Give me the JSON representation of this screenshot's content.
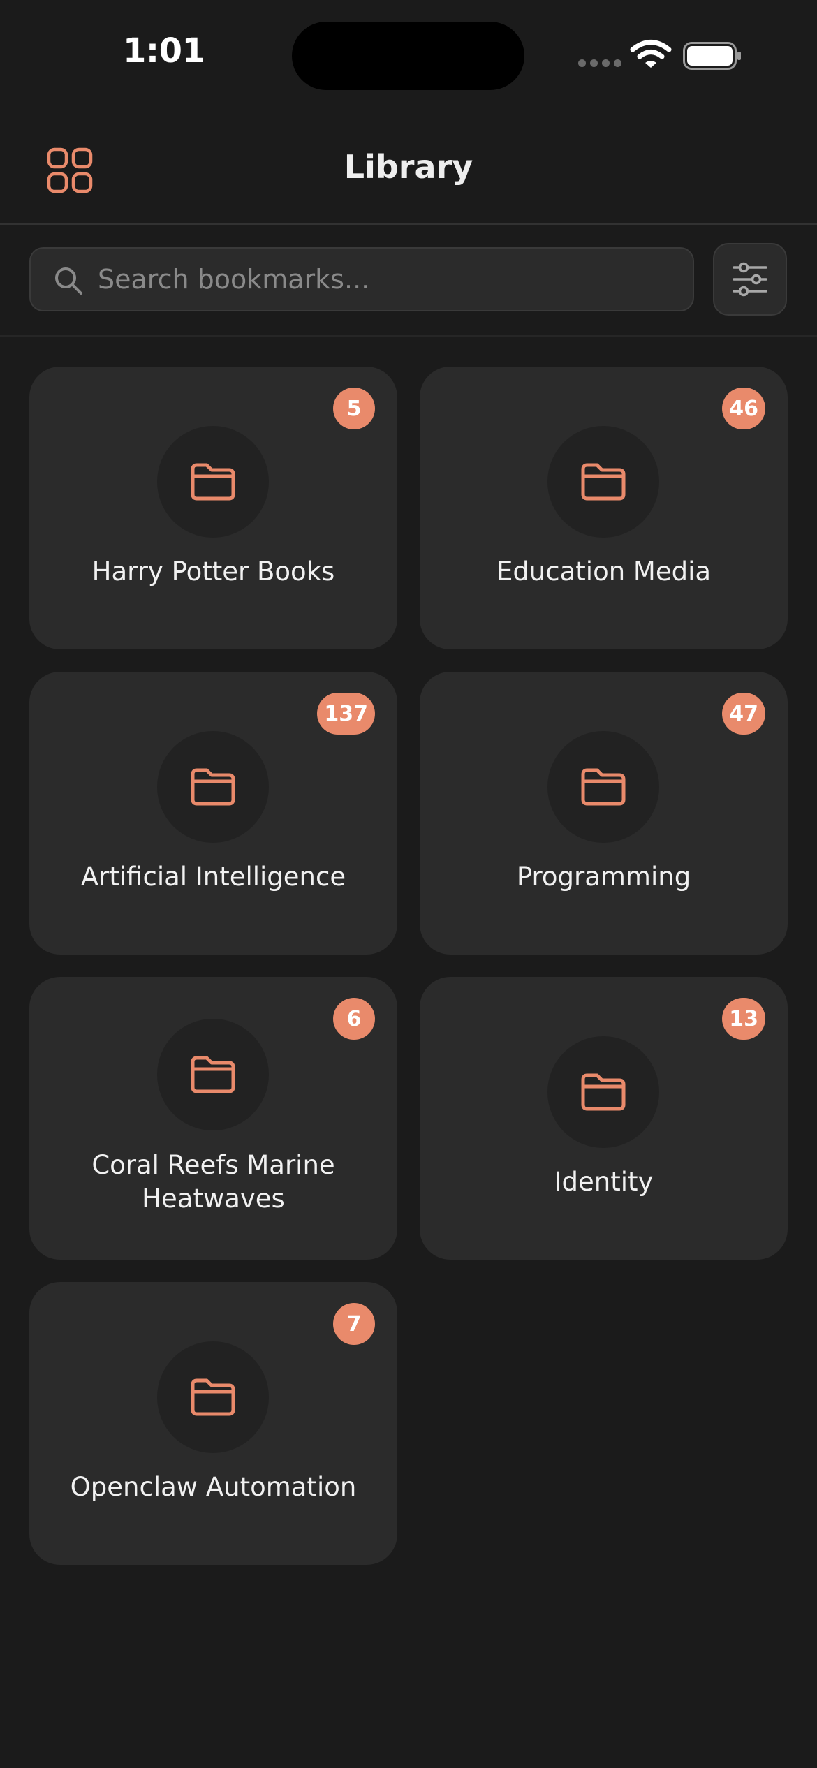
{
  "status_bar": {
    "time": "1:01",
    "icons": [
      "cellular-signal-icon",
      "wifi-icon",
      "battery-icon"
    ]
  },
  "header": {
    "title": "Library",
    "left_icon": "grid-icon"
  },
  "search": {
    "placeholder": "Search bookmarks...",
    "value": "",
    "filter_icon": "sliders-icon"
  },
  "colors": {
    "accent": "#e98a6b",
    "background": "#1b1b1b",
    "card": "#2b2b2b"
  },
  "folders": [
    {
      "name": "Harry Potter Books",
      "count": "5"
    },
    {
      "name": "Education Media",
      "count": "46"
    },
    {
      "name": "Artificial Intelligence",
      "count": "137"
    },
    {
      "name": "Programming",
      "count": "47"
    },
    {
      "name": "Coral Reefs Marine Heatwaves",
      "count": "6"
    },
    {
      "name": "Identity",
      "count": "13"
    },
    {
      "name": "Openclaw Automation",
      "count": "7"
    }
  ]
}
